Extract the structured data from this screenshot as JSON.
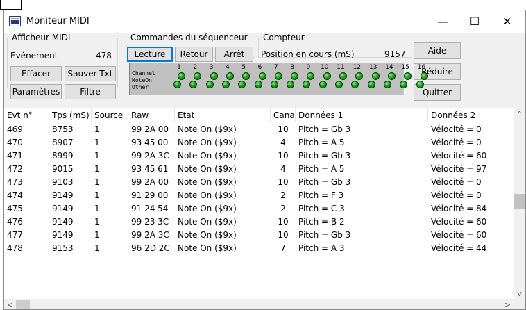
{
  "window": {
    "title": "Moniteur MIDI",
    "minimize_glyph": "—",
    "maximize_glyph": "☐",
    "close_glyph": "✕"
  },
  "afficheur": {
    "legend": "Afficheur MIDI",
    "event_label": "Evénement",
    "event_value": "478",
    "effacer": "Effacer",
    "sauver": "Sauver Txt",
    "parametres": "Paramètres",
    "filtre": "Filtre"
  },
  "sequencer": {
    "legend": "Commandes du séquenceur",
    "lecture": "Lecture",
    "retour": "Retour",
    "arret": "Arrêt"
  },
  "counter": {
    "legend": "Compteur",
    "label": "Position en cours (mS)",
    "value": "9157"
  },
  "side_buttons": {
    "aide": "Aide",
    "reduire": "Réduire",
    "quitter": "Quitter"
  },
  "channels": {
    "row_labels": [
      "Channel",
      "NoteOn",
      "Other"
    ],
    "numbers": [
      "1",
      "2",
      "3",
      "4",
      "5",
      "6",
      "7",
      "8",
      "9",
      "10",
      "11",
      "12",
      "13",
      "14",
      "15",
      "16"
    ],
    "led_color": "#1fa11f"
  },
  "table": {
    "columns": [
      "Evt n°",
      "Tps (mS)",
      "Source",
      "Raw",
      "Etat",
      "Canal",
      "Données 1",
      "Données 2"
    ],
    "rows": [
      [
        "469",
        "8753",
        "1",
        "99 2A 00",
        "Note On ($9x)",
        "10",
        "Pitch = Gb  3",
        "Vélocité =   0"
      ],
      [
        "470",
        "8907",
        "1",
        "93 45 00",
        "Note On ($9x)",
        "4",
        "Pitch = A  5",
        "Vélocité =   0"
      ],
      [
        "471",
        "8999",
        "1",
        "99 2A 3C",
        "Note On ($9x)",
        "10",
        "Pitch = Gb  3",
        "Vélocité =  60"
      ],
      [
        "472",
        "9015",
        "1",
        "93 45 61",
        "Note On ($9x)",
        "4",
        "Pitch = A  5",
        "Vélocité =  97"
      ],
      [
        "473",
        "9103",
        "1",
        "99 2A 00",
        "Note On ($9x)",
        "10",
        "Pitch = Gb  3",
        "Vélocité =   0"
      ],
      [
        "474",
        "9149",
        "1",
        "91 29 00",
        "Note On ($9x)",
        "2",
        "Pitch = F  3",
        "Vélocité =   0"
      ],
      [
        "475",
        "9149",
        "1",
        "91 24 54",
        "Note On ($9x)",
        "2",
        "Pitch = C  3",
        "Vélocité =  84"
      ],
      [
        "476",
        "9149",
        "1",
        "99 23 3C",
        "Note On ($9x)",
        "10",
        "Pitch = B  2",
        "Vélocité =  60"
      ],
      [
        "477",
        "9149",
        "1",
        "99 2A 3C",
        "Note On ($9x)",
        "10",
        "Pitch = Gb  3",
        "Vélocité =  60"
      ],
      [
        "478",
        "9153",
        "1",
        "96 2D 2C",
        "Note On ($9x)",
        "7",
        "Pitch = A  3",
        "Vélocité =  44"
      ]
    ]
  }
}
